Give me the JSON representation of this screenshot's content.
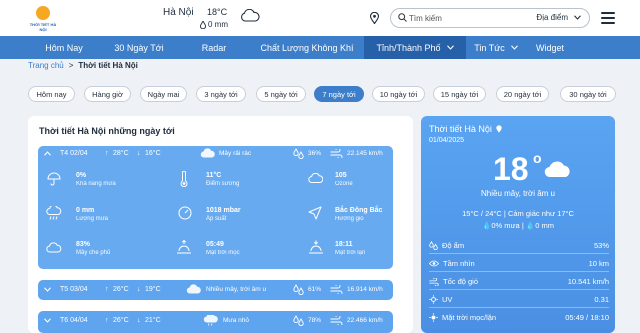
{
  "header": {
    "logo_text": "THỜI TIẾT HÀ NỘI",
    "location": "Hà Nội",
    "temperature": "18°C",
    "rain": "0 mm",
    "search_placeholder": "Tìm kiếm",
    "search_select": "Địa điểm"
  },
  "nav": [
    {
      "label": "Hôm Nay"
    },
    {
      "label": "30 Ngày Tới"
    },
    {
      "label": "Radar"
    },
    {
      "label": "Chất Lượng Không Khí"
    },
    {
      "label": "Tỉnh/Thành Phố"
    },
    {
      "label": "Tin Tức"
    },
    {
      "label": "Widget"
    }
  ],
  "breadcrumb": {
    "home": "Trang chủ",
    "sep": ">",
    "current": "Thời tiết Hà Nội"
  },
  "tabs": [
    {
      "label": "Hôm nay"
    },
    {
      "label": "Hàng giờ"
    },
    {
      "label": "Ngày mai"
    },
    {
      "label": "3 ngày tới"
    },
    {
      "label": "5 ngày tới"
    },
    {
      "label": "7 ngày tới"
    },
    {
      "label": "10 ngày tới"
    },
    {
      "label": "15 ngày tới"
    },
    {
      "label": "20 ngày tới"
    },
    {
      "label": "30 ngày tới"
    }
  ],
  "forecast": {
    "title": "Thời tiết Hà Nội những ngày tới",
    "days": [
      {
        "date": "T4 02/04",
        "max": "28°C",
        "min": "16°C",
        "desc": "Mây rải rác",
        "humidity": "36%",
        "wind": "22.145 km/h",
        "details": [
          {
            "value": "0%",
            "label": "Khả năng mưa"
          },
          {
            "value": "11°C",
            "label": "Điểm sương"
          },
          {
            "value": "105",
            "label": "Ozone"
          },
          {
            "value": "0 mm",
            "label": "Lượng mưa"
          },
          {
            "value": "1018 mbar",
            "label": "Áp suất"
          },
          {
            "value": "Bắc Đông Bắc",
            "label": "Hướng gió"
          },
          {
            "value": "83%",
            "label": "Mây che phủ"
          },
          {
            "value": "05:49",
            "label": "Mặt trời mọc"
          },
          {
            "value": "18:11",
            "label": "Mặt trời lặn"
          }
        ]
      },
      {
        "date": "T5 03/04",
        "max": "26°C",
        "min": "19°C",
        "desc": "Nhiều mây, trời âm u",
        "humidity": "61%",
        "wind": "16.914 km/h"
      },
      {
        "date": "T6 04/04",
        "max": "26°C",
        "min": "21°C",
        "desc": "Mưa nhỏ",
        "humidity": "78%",
        "wind": "22.466 km/h"
      }
    ]
  },
  "current": {
    "title": "Thời tiết Hà Nội",
    "date": "01/04/2025",
    "temp": "18",
    "deg": "o",
    "desc": "Nhiều mây, trời âm u",
    "range": "15°C / 24°C | Cảm giác như 17°C",
    "rain_chance": "0% mưa",
    "rain_sep": "|",
    "rain_amount": "0 mm",
    "rows": [
      {
        "label": "Độ ẩm",
        "value": "53%"
      },
      {
        "label": "Tầm nhìn",
        "value": "10 km"
      },
      {
        "label": "Tốc độ gió",
        "value": "10.541 km/h"
      },
      {
        "label": "UV",
        "value": "0.31"
      },
      {
        "label": "Mặt trời mọc/lặn",
        "value": "05:49 / 18:10"
      }
    ]
  },
  "colors": {
    "nav": "#3d7ecb",
    "nav_active": "#2560a8",
    "card": "#5fa4ef",
    "sun": "#f7a823"
  }
}
